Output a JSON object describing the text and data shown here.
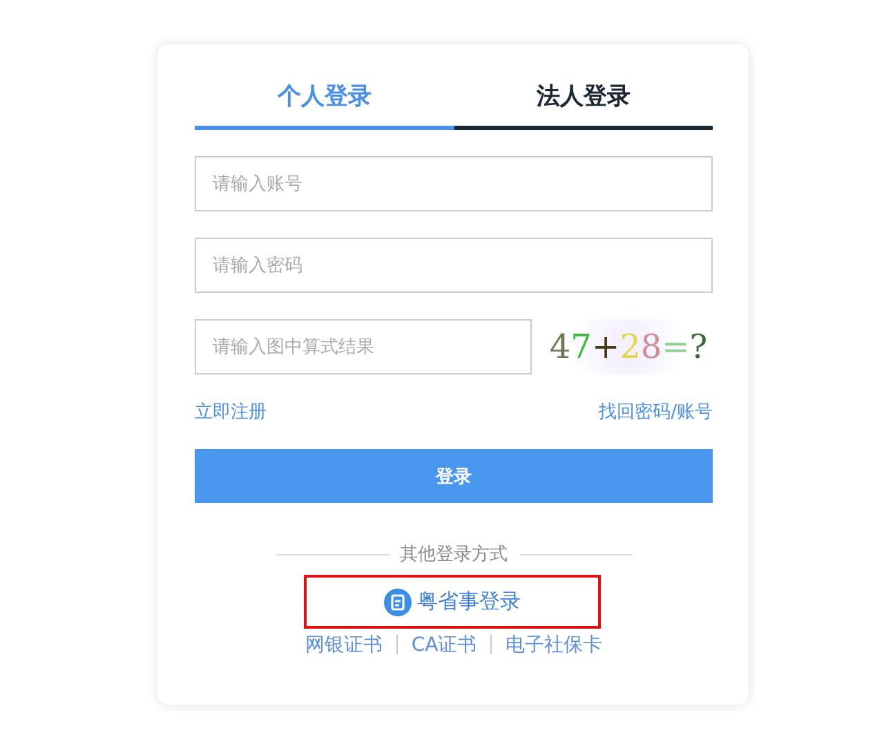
{
  "tabs": [
    {
      "label": "个人登录",
      "selected": true
    },
    {
      "label": "法人登录",
      "selected": false
    }
  ],
  "fields": [
    {
      "placeholder": "请输入账号"
    },
    {
      "placeholder": "请输入密码"
    }
  ],
  "captcha": {
    "placeholder": "请输入图中算式结果",
    "image_text": "47+28=?"
  },
  "links": {
    "register": "立即注册",
    "recover": "找回密码/账号"
  },
  "login_button": "登录",
  "other_methods": {
    "heading": "其他登录方式",
    "primary": {
      "label": "粤省事登录",
      "highlighted": true
    },
    "options": [
      "网银证书",
      "CA证书",
      "电子社保卡"
    ],
    "separator": "|"
  }
}
